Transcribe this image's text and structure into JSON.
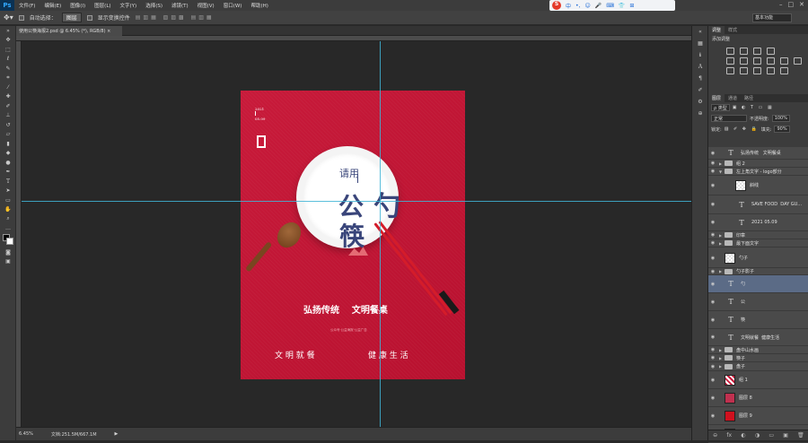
{
  "app": {
    "logo": "Ps",
    "menu": [
      "文件(F)",
      "编辑(E)",
      "图像(I)",
      "图层(L)",
      "文字(Y)",
      "选择(S)",
      "滤镜(T)",
      "视图(V)",
      "窗口(W)",
      "帮助(H)"
    ],
    "window_controls": [
      "–",
      "□",
      "✕"
    ]
  },
  "ime": {
    "logo": "S",
    "items": [
      "中",
      "•,",
      "☺",
      "🎤",
      "⌨",
      "👕",
      "⊞"
    ]
  },
  "options": {
    "auto_select_label": "自动选择：",
    "auto_select_value": "图层",
    "show_transform_label": "显示变换控件",
    "workspace": "基本功能"
  },
  "document": {
    "tab_label": "使用公筷海报2.psd @ 6.45% (*), RGB/8) ×",
    "zoom": "6.45%",
    "doc_size": "文档:251.5M/667.1M"
  },
  "poster": {
    "date_year": "2021",
    "date_md": "05.09",
    "please_use": "请用",
    "gong": "公",
    "shao": "勺",
    "kuai": "筷",
    "slogan": "弘扬传统    文明餐桌",
    "small_line": "公众号·公益海报·公益广告",
    "bottom_left": "文 明 就 餐",
    "bottom_right": "健 康 生 活"
  },
  "panels": {
    "top_tabs": [
      "调整",
      "样式"
    ],
    "adjust_title": "添加调整",
    "layer_tabs": [
      "图层",
      "通道",
      "路径"
    ],
    "kind_label": "ρ 类型",
    "blend_mode": "正常",
    "opacity_label": "不透明度:",
    "opacity_value": "100%",
    "lock_label": "锁定:",
    "fill_label": "填充:",
    "fill_value": "90%"
  },
  "layers": [
    {
      "name": "弘扬传统   文明餐桌",
      "type": "text",
      "arrow": ""
    },
    {
      "name": "组 2",
      "type": "folder",
      "arrow": "▶"
    },
    {
      "name": "左上角文字 - logo部分",
      "type": "folder",
      "arrow": "▼"
    },
    {
      "name": "斜线",
      "type": "pixel",
      "arrow": ""
    },
    {
      "name": "SAVE FOOD  DAY GU...",
      "type": "text",
      "arrow": ""
    },
    {
      "name": "2021 05.09",
      "type": "text",
      "arrow": ""
    },
    {
      "name": "印章",
      "type": "folder",
      "arrow": "▶"
    },
    {
      "name": "最下面文字",
      "type": "folder",
      "arrow": "▶"
    },
    {
      "name": "勺子",
      "type": "pixel",
      "arrow": ""
    },
    {
      "name": "勺子影子",
      "type": "folder",
      "arrow": "▶"
    },
    {
      "name": "勺",
      "type": "text",
      "arrow": ""
    },
    {
      "name": "公",
      "type": "text",
      "arrow": ""
    },
    {
      "name": "筷",
      "type": "text",
      "arrow": ""
    },
    {
      "name": "文明就餐  健康生活",
      "type": "text",
      "arrow": ""
    },
    {
      "name": "盘中山水画",
      "type": "folder",
      "arrow": "▶"
    },
    {
      "name": "筷子",
      "type": "folder",
      "arrow": "▶"
    },
    {
      "name": "盘子",
      "type": "folder",
      "arrow": "▶"
    },
    {
      "name": "组 1",
      "type": "striped",
      "arrow": ""
    },
    {
      "name": "图层 8",
      "type": "pink",
      "arrow": ""
    },
    {
      "name": "图层 9",
      "type": "red",
      "arrow": ""
    },
    {
      "name": "背景",
      "type": "white",
      "arrow": ""
    }
  ],
  "layer_footer": [
    "⊖",
    "fx",
    "◐",
    "◑",
    "▭",
    "▣",
    "🗑"
  ],
  "colors": {
    "poster_red": "#c81a3a",
    "navy": "#39457a",
    "guide": "#3fb4d6",
    "selection": "#5b6b86"
  }
}
